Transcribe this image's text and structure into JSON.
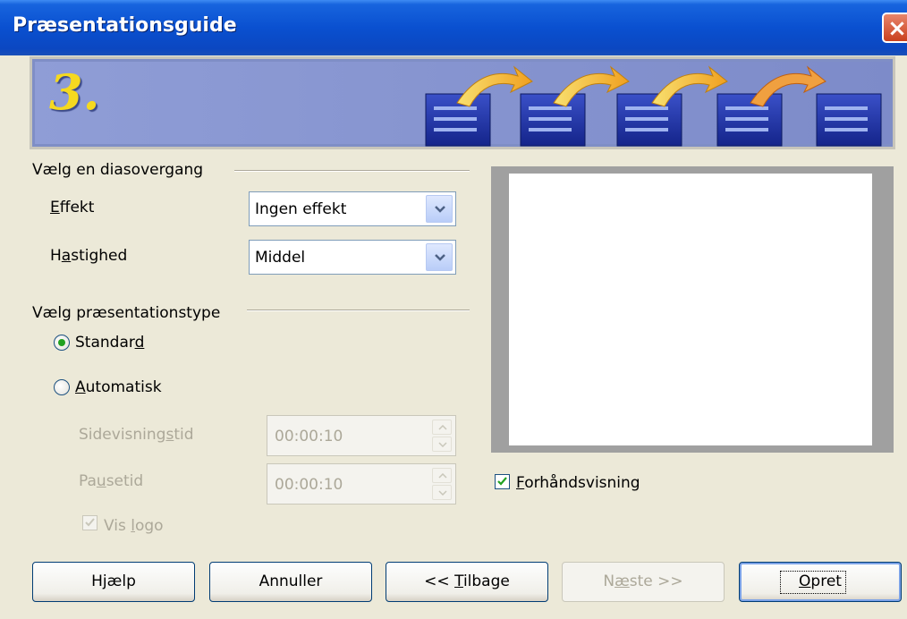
{
  "window": {
    "title": "Præsentationsguide"
  },
  "banner": {
    "step": "3."
  },
  "transition": {
    "section_title": "Vælg en diasovergang",
    "effect_label": "Effekt",
    "effect_accel": "E",
    "effect_rest": "ffekt",
    "effect_value": "Ingen effekt",
    "speed_label_pre": "H",
    "speed_accel": "a",
    "speed_label_post": "stighed",
    "speed_value": "Middel"
  },
  "type": {
    "section_title": "Vælg præsentationstype",
    "standard_pre": "Standar",
    "standard_accel": "d",
    "automatic_accel": "A",
    "automatic_rest": "utomatisk",
    "selected": "Standard",
    "page_duration_pre": "Sidevisning",
    "page_duration_accel": "s",
    "page_duration_post": "tid",
    "page_duration_value": "00:00:10",
    "pause_pre": "Pa",
    "pause_accel": "u",
    "pause_post": "setid",
    "pause_value": "00:00:10",
    "show_logo_pre": "Vis ",
    "show_logo_accel": "l",
    "show_logo_post": "ogo",
    "show_logo_checked": true
  },
  "preview": {
    "checkbox_accel": "F",
    "checkbox_rest": "orhåndsvisning",
    "checked": true
  },
  "buttons": {
    "help_pre": "H",
    "help_accel": "j",
    "help_post": "ælp",
    "cancel": "Annuller",
    "back_pre": "<< ",
    "back_accel": "T",
    "back_post": "ilbage",
    "next_pre": "N",
    "next_accel": "æ",
    "next_post": "ste >>",
    "create_accel": "O",
    "create_post": "pret"
  },
  "colors": {
    "titlebar": "#0a50d0",
    "banner": "#7f8ec6",
    "step_number": "#f5d91f",
    "arrow": "#f2c63a",
    "page_icon": "#1a2f9a"
  }
}
